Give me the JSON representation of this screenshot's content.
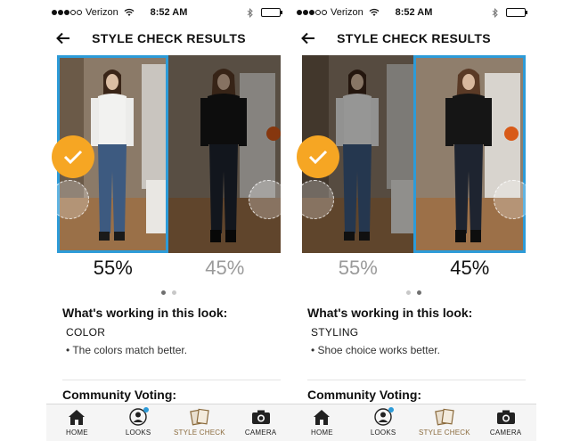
{
  "colors": {
    "accent_orange": "#f6a623",
    "select_blue": "#2d9bd8",
    "muted_text": "#9a9a9a",
    "tab_active": "#8a6a3c"
  },
  "status_bar": {
    "carrier": "Verizon",
    "time": "8:52 AM"
  },
  "header": {
    "title": "STYLE CHECK RESULTS",
    "back_icon": "back-arrow-icon"
  },
  "screens": [
    {
      "selected_photo": 1,
      "percent_1": "55%",
      "percent_2": "45%",
      "page_index": 1,
      "section_title": "What's working in this look:",
      "category": "COLOR",
      "reason": "• The colors match better.",
      "community_title": "Community Voting:"
    },
    {
      "selected_photo": 2,
      "percent_1": "55%",
      "percent_2": "45%",
      "page_index": 2,
      "section_title": "What's working in this look:",
      "category": "STYLING",
      "reason": "• Shoe choice works better.",
      "community_title": "Community Voting:"
    }
  ],
  "tabbar": {
    "items": [
      {
        "label": "HOME",
        "icon": "home-icon"
      },
      {
        "label": "LOOKS",
        "icon": "looks-icon"
      },
      {
        "label": "STYLE CHECK",
        "icon": "style-check-icon"
      },
      {
        "label": "CAMERA",
        "icon": "camera-icon"
      }
    ],
    "active_index": 2
  }
}
